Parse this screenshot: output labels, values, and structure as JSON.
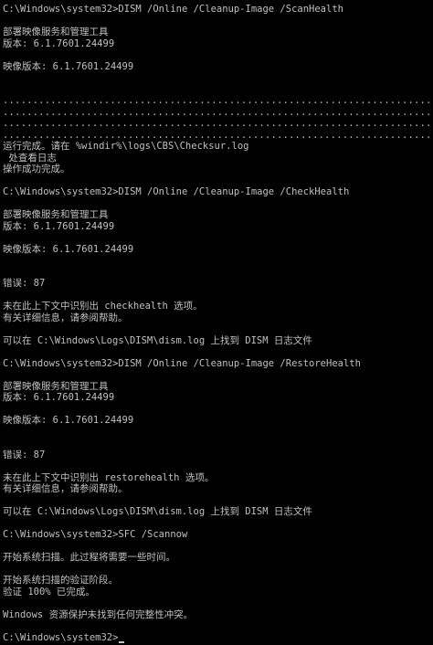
{
  "lines": [
    {
      "type": "text",
      "text": "C:\\Windows\\system32>DISM /Online /Cleanup-Image /ScanHealth"
    },
    {
      "type": "blank",
      "text": ""
    },
    {
      "type": "text",
      "text": "部署映像服务和管理工具"
    },
    {
      "type": "text",
      "text": "版本: 6.1.7601.24499"
    },
    {
      "type": "blank",
      "text": ""
    },
    {
      "type": "text",
      "text": "映像版本: 6.1.7601.24499"
    },
    {
      "type": "blank",
      "text": ""
    },
    {
      "type": "blank",
      "text": ""
    },
    {
      "type": "dots",
      "text": "...................................................................................."
    },
    {
      "type": "dots",
      "text": "...................................................................................."
    },
    {
      "type": "dots",
      "text": "...................................................................................."
    },
    {
      "type": "dots",
      "text": "...........................................................................scanhe"
    },
    {
      "type": "text",
      "text": "运行完成。请在 %windir%\\logs\\CBS\\Checksur.log"
    },
    {
      "type": "text",
      "text": " 处查看日志"
    },
    {
      "type": "text",
      "text": "操作成功完成。"
    },
    {
      "type": "blank",
      "text": ""
    },
    {
      "type": "text",
      "text": "C:\\Windows\\system32>DISM /Online /Cleanup-Image /CheckHealth"
    },
    {
      "type": "blank",
      "text": ""
    },
    {
      "type": "text",
      "text": "部署映像服务和管理工具"
    },
    {
      "type": "text",
      "text": "版本: 6.1.7601.24499"
    },
    {
      "type": "blank",
      "text": ""
    },
    {
      "type": "text",
      "text": "映像版本: 6.1.7601.24499"
    },
    {
      "type": "blank",
      "text": ""
    },
    {
      "type": "blank",
      "text": ""
    },
    {
      "type": "text",
      "text": "错误: 87"
    },
    {
      "type": "blank",
      "text": ""
    },
    {
      "type": "text",
      "text": "未在此上下文中识别出 checkhealth 选项。"
    },
    {
      "type": "text",
      "text": "有关详细信息，请参阅帮助。"
    },
    {
      "type": "blank",
      "text": ""
    },
    {
      "type": "text",
      "text": "可以在 C:\\Windows\\Logs\\DISM\\dism.log 上找到 DISM 日志文件"
    },
    {
      "type": "blank",
      "text": ""
    },
    {
      "type": "text",
      "text": "C:\\Windows\\system32>DISM /Online /Cleanup-Image /RestoreHealth"
    },
    {
      "type": "blank",
      "text": ""
    },
    {
      "type": "text",
      "text": "部署映像服务和管理工具"
    },
    {
      "type": "text",
      "text": "版本: 6.1.7601.24499"
    },
    {
      "type": "blank",
      "text": ""
    },
    {
      "type": "text",
      "text": "映像版本: 6.1.7601.24499"
    },
    {
      "type": "blank",
      "text": ""
    },
    {
      "type": "blank",
      "text": ""
    },
    {
      "type": "text",
      "text": "错误: 87"
    },
    {
      "type": "blank",
      "text": ""
    },
    {
      "type": "text",
      "text": "未在此上下文中识别出 restorehealth 选项。"
    },
    {
      "type": "text",
      "text": "有关详细信息，请参阅帮助。"
    },
    {
      "type": "blank",
      "text": ""
    },
    {
      "type": "text",
      "text": "可以在 C:\\Windows\\Logs\\DISM\\dism.log 上找到 DISM 日志文件"
    },
    {
      "type": "blank",
      "text": ""
    },
    {
      "type": "text",
      "text": "C:\\Windows\\system32>SFC /Scannow"
    },
    {
      "type": "blank",
      "text": ""
    },
    {
      "type": "text",
      "text": "开始系统扫描。此过程将需要一些时间。"
    },
    {
      "type": "blank",
      "text": ""
    },
    {
      "type": "text",
      "text": "开始系统扫描的验证阶段。"
    },
    {
      "type": "text",
      "text": "验证 100% 已完成。"
    },
    {
      "type": "blank",
      "text": ""
    },
    {
      "type": "text",
      "text": "Windows 资源保护未找到任何完整性冲突。"
    },
    {
      "type": "blank",
      "text": ""
    },
    {
      "type": "prompt",
      "text": "C:\\Windows\\system32>"
    }
  ],
  "colors": {
    "background": "#000000",
    "foreground": "#c0c0c0"
  }
}
